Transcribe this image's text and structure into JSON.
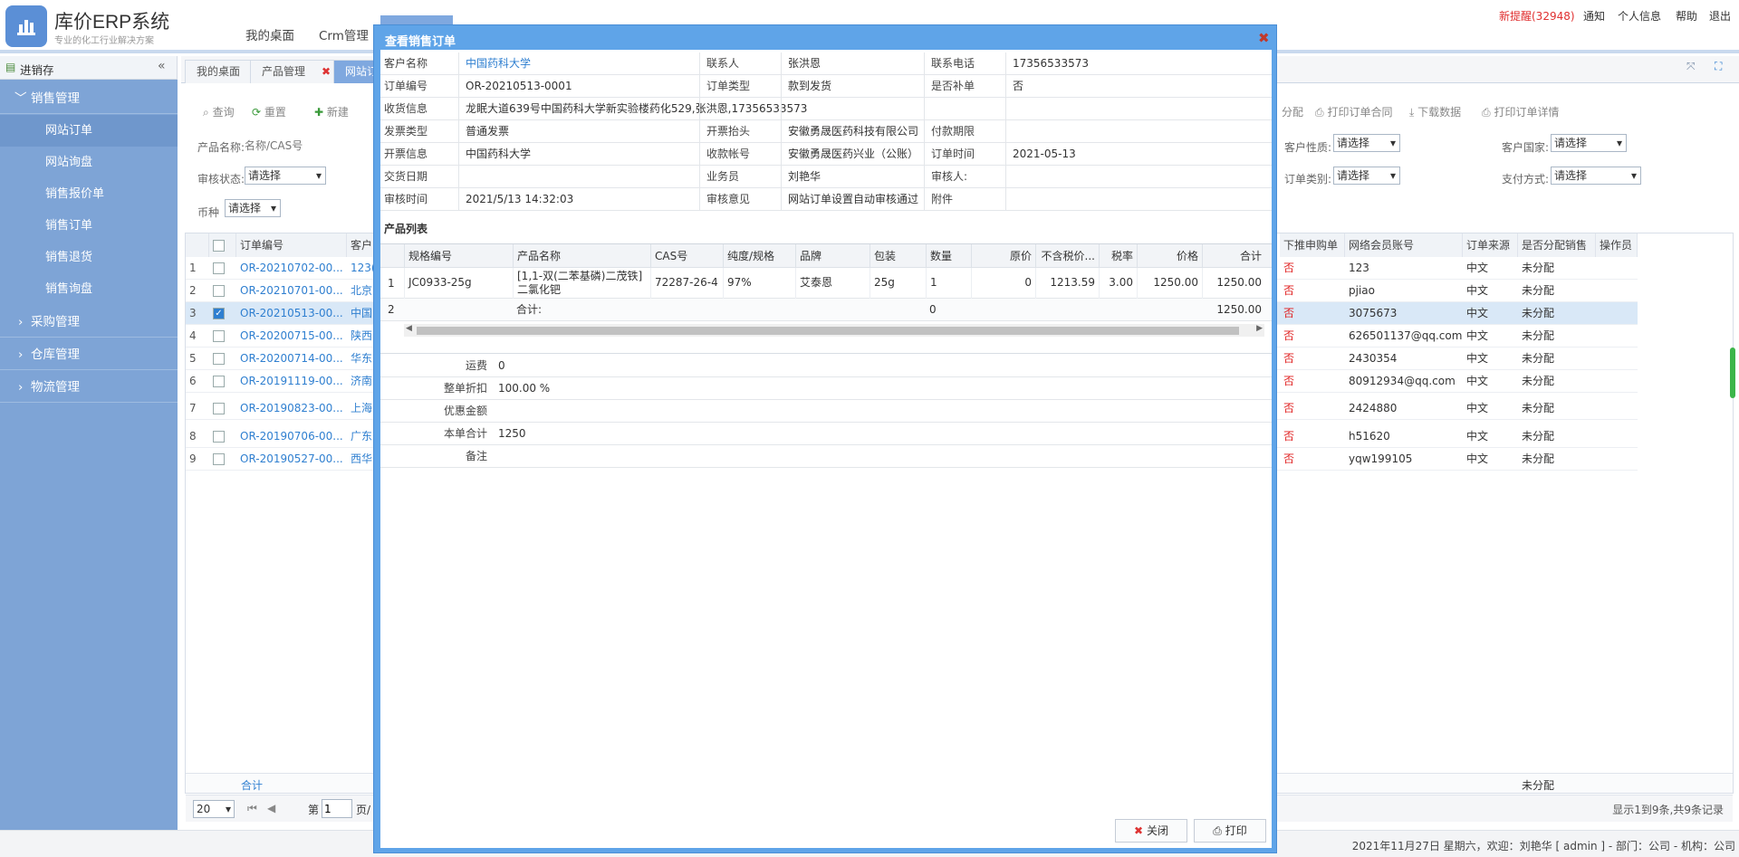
{
  "header": {
    "title": "库价ERP系统",
    "subtitle": "专业的化工行业解决方案",
    "nav": [
      "我的桌面",
      "Crm管理"
    ],
    "notify": "新提醒(32948)",
    "links": [
      "通知",
      "个人信息",
      "帮助",
      "退出"
    ]
  },
  "sidebar": {
    "title": "进销存",
    "groups": [
      {
        "label": "销售管理",
        "items": [
          "网站订单",
          "网站询盘",
          "销售报价单",
          "销售订单",
          "销售退货",
          "销售询盘"
        ]
      },
      {
        "label": "采购管理"
      },
      {
        "label": "仓库管理"
      },
      {
        "label": "物流管理"
      }
    ]
  },
  "tabs": [
    "我的桌面",
    "产品管理",
    "网站订"
  ],
  "toolbar": {
    "left": [
      "查询",
      "重置",
      "新建"
    ],
    "right": [
      "分配",
      "打印订单合同",
      "下载数据",
      "打印订单详情"
    ]
  },
  "filters": {
    "product_label": "产品名称:",
    "product_placeholder": "名称/CAS号",
    "audit_label": "审核状态:",
    "audit_value": "请选择",
    "currency_label": "币种",
    "currency_value": "请选择",
    "cust_nature_label": "客户性质:",
    "cust_nature_value": "请选择",
    "cust_country_label": "客户国家:",
    "cust_country_value": "请选择",
    "order_cat_label": "订单类别:",
    "order_cat_value": "请选择",
    "pay_label": "支付方式:",
    "pay_value": "请选择"
  },
  "grid": {
    "headers_left": [
      "订单编号",
      "客户"
    ],
    "headers_right": [
      "下推申购单",
      "网络会员账号",
      "订单来源",
      "是否分配销售",
      "操作员"
    ],
    "rows": [
      {
        "n": "1",
        "order": "OR-20210702-00...",
        "cust": "123(",
        "push": "否",
        "member": "123",
        "src": "中文",
        "assign": "未分配",
        "checked": false
      },
      {
        "n": "2",
        "order": "OR-20210701-00...",
        "cust": "北京",
        "push": "否",
        "member": "pjiao",
        "src": "中文",
        "assign": "未分配",
        "checked": false
      },
      {
        "n": "3",
        "order": "OR-20210513-00...",
        "cust": "中国",
        "push": "否",
        "member": "3075673",
        "src": "中文",
        "assign": "未分配",
        "checked": true
      },
      {
        "n": "4",
        "order": "OR-20200715-00...",
        "cust": "陕西",
        "push": "否",
        "member": "626501137@qq.com",
        "src": "中文",
        "assign": "未分配",
        "checked": false
      },
      {
        "n": "5",
        "order": "OR-20200714-00...",
        "cust": "华东",
        "push": "否",
        "member": "2430354",
        "src": "中文",
        "assign": "未分配",
        "checked": false
      },
      {
        "n": "6",
        "order": "OR-20191119-00...",
        "cust": "济南",
        "push": "否",
        "member": "80912934@qq.com",
        "src": "中文",
        "assign": "未分配",
        "checked": false
      },
      {
        "n": "7",
        "order": "OR-20190823-00...",
        "cust": "上海",
        "push": "否",
        "member": "2424880",
        "src": "中文",
        "assign": "未分配",
        "checked": false
      },
      {
        "n": "8",
        "order": "OR-20190706-00...",
        "cust": "广东",
        "push": "否",
        "member": "h51620",
        "src": "中文",
        "assign": "未分配",
        "checked": false
      },
      {
        "n": "9",
        "order": "OR-20190527-00...",
        "cust": "西华",
        "push": "否",
        "member": "yqw199105",
        "src": "中文",
        "assign": "未分配",
        "checked": false
      }
    ],
    "total_label": "合计",
    "total_assign": "未分配",
    "page_size": "20",
    "page_prefix": "第",
    "page_value": "1",
    "page_suffix": "页/",
    "info": "显示1到9条,共9条记录"
  },
  "footer": "2021年11月27日 星期六，欢迎：刘艳华 [ admin ] - 部门：公司 - 机构：公司",
  "modal": {
    "title": "查看销售订单",
    "info": [
      [
        "客户名称",
        "中国药科大学",
        "联系人",
        "张洪恩",
        "联系电话",
        "17356533573"
      ],
      [
        "订单编号",
        "OR-20210513-0001",
        "订单类型",
        "款到发货",
        "是否补单",
        "否"
      ],
      [
        "收货信息",
        "龙眠大道639号中国药科大学新实验楼药化529,张洪恩,17356533573"
      ],
      [
        "发票类型",
        "普通发票",
        "开票抬头",
        "安徽勇晟医药科技有限公司",
        "付款期限",
        ""
      ],
      [
        "开票信息",
        "中国药科大学",
        "收款帐号",
        "安徽勇晟医药兴业（公账）",
        "订单时间",
        "2021-05-13"
      ],
      [
        "交货日期",
        "",
        "业务员",
        "刘艳华",
        "审核人:",
        ""
      ],
      [
        "审核时间",
        "2021/5/13 14:32:03",
        "审核意见",
        "网站订单设置自动审核通过",
        "附件",
        ""
      ]
    ],
    "product_list_title": "产品列表",
    "product_headers": [
      "规格编号",
      "产品名称",
      "CAS号",
      "纯度/规格",
      "品牌",
      "包装",
      "数量",
      "原价",
      "不含税价...",
      "税率",
      "价格",
      "合计"
    ],
    "product_rows": [
      [
        "1",
        "JC0933-25g",
        "[1,1-双(二苯基磷)二茂铁]二氯化钯",
        "72287-26-4",
        "97%",
        "艾泰恩",
        "25g",
        "1",
        "0",
        "1213.59",
        "3.00",
        "1250.00",
        "1250.00"
      ]
    ],
    "product_total": {
      "n": "2",
      "label": "合计:",
      "qty": "0",
      "sum": "1250.00"
    },
    "summary": [
      [
        "运费",
        "0"
      ],
      [
        "整单折扣",
        "100.00 %"
      ],
      [
        "优惠金额",
        ""
      ],
      [
        "本单合计",
        "1250"
      ],
      [
        "备注",
        ""
      ]
    ],
    "close_label": "关闭",
    "print_label": "打印"
  }
}
